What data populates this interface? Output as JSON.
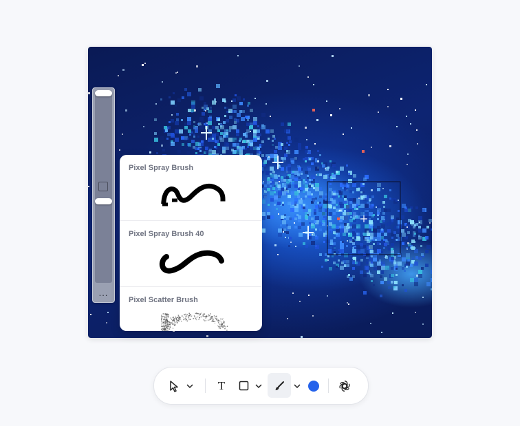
{
  "canvas": {
    "image_label": "pixelated blue nebula artwork"
  },
  "slider_panel": {
    "more_label": "..."
  },
  "brush_list": {
    "items": [
      {
        "name": "Pixel Spray Brush"
      },
      {
        "name": "Pixel Spray Brush 40"
      },
      {
        "name": "Pixel Scatter Brush"
      }
    ]
  },
  "toolbar": {
    "tools": [
      {
        "icon": "cursor-arrow-icon"
      },
      {
        "icon": "chevron-down-icon"
      },
      {
        "icon": "text-tool-icon",
        "glyph": "T"
      },
      {
        "icon": "rectangle-icon"
      },
      {
        "icon": "chevron-down-icon"
      },
      {
        "icon": "brush-icon",
        "active": true
      },
      {
        "icon": "chevron-down-icon"
      },
      {
        "icon": "color-swatch-icon"
      },
      {
        "icon": "openai-logo-icon"
      }
    ],
    "selected_color": "#2563eb"
  }
}
